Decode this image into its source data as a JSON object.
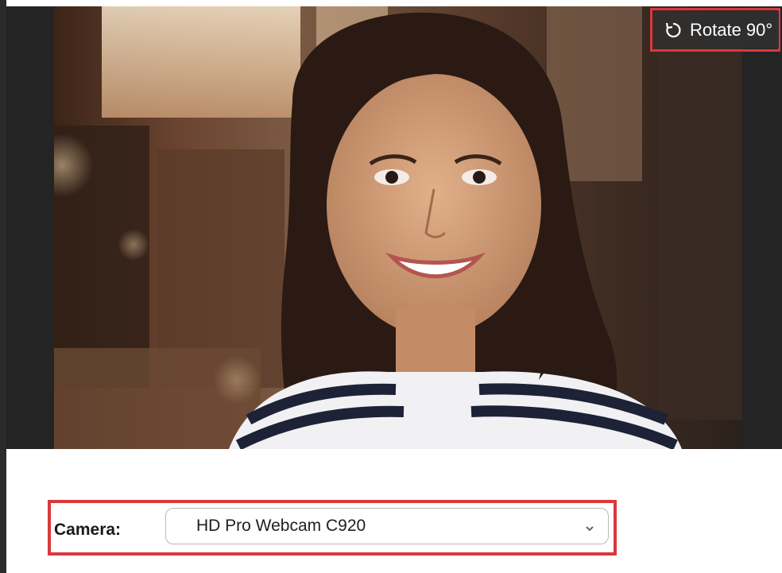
{
  "preview": {
    "rotate_label": "Rotate 90°",
    "rotate_icon": "rotate-ccw-icon"
  },
  "camera": {
    "label": "Camera:",
    "selected": "HD Pro Webcam C920",
    "dropdown_icon": "chevron-down-icon"
  },
  "colors": {
    "highlight": "#d9393c",
    "button_bg": "#303030",
    "frame": "#242424"
  }
}
